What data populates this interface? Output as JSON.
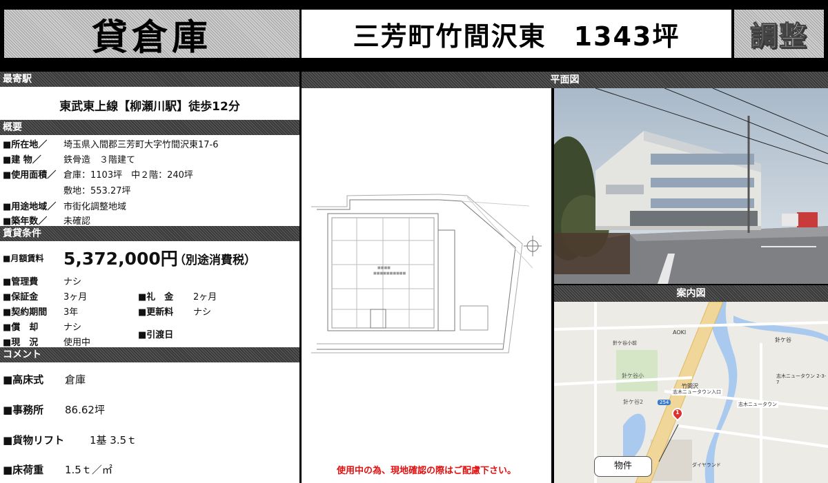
{
  "header": {
    "title": "貸倉庫",
    "subtitle": "三芳町竹間沢東　1343坪",
    "status": "調整"
  },
  "station": {
    "header": "最寄駅",
    "text": "東武東上線【柳瀬川駅】徒歩12分"
  },
  "overview": {
    "header": "概要",
    "location_label": "■所在地／",
    "location_value": "埼玉県入間郡三芳町大字竹間沢東17-6",
    "building_label": "■建 物／",
    "building_value": "鉄骨造　３階建て",
    "area_label": "■使用面積／",
    "area_value": "倉庫：1103坪　中２階：240坪",
    "site_value": "敷地：553.27坪",
    "zone_label": "■用途地域／",
    "zone_value": "市街化調整地域",
    "age_label": "■築年数／",
    "age_value": "未確認"
  },
  "lease": {
    "header": "賃貸条件",
    "rent_label": "■月額賃料",
    "rent_value": "5,372,000円",
    "rent_tax": "（別途消費税）",
    "mgmt_label": "■管理費",
    "mgmt_value": "ナシ",
    "deposit_label": "■保証金",
    "deposit_value": "3ヶ月",
    "key_label": "■礼　金",
    "key_value": "2ヶ月",
    "term_label": "■契約期間",
    "term_value": "3年",
    "renew_label": "■更新料",
    "renew_value": "ナシ",
    "amort_label": "■償　却",
    "amort_value": "ナシ",
    "current_label": "■現　況",
    "current_value": "使用中",
    "handover_label": "■引渡日"
  },
  "comment": {
    "header": "コメント",
    "items": [
      {
        "label": "■高床式",
        "value": "倉庫"
      },
      {
        "label": "■事務所",
        "value": "86.62坪"
      },
      {
        "label": "■貨物リフト",
        "value": "1基 3.5ｔ"
      },
      {
        "label": "■床荷重",
        "value": "1.5ｔ／㎡"
      }
    ]
  },
  "floorplan": {
    "header": "平面図",
    "notice": "使用中の為、現地確認の際はご配慮下さい。"
  },
  "map": {
    "header": "案内図",
    "marker_label": "物件",
    "marker_num": "1",
    "labels": {
      "aoki": "AOKI",
      "harigaya_sho": "針ケ谷小",
      "harigaya2": "針ケ谷2",
      "takemazawa": "竹間沢",
      "shiki_nt_iriguchi": "志木ニュータウン入口",
      "shiki_nt": "志木ニュータウン",
      "harigaya": "針ケ谷",
      "route": "254",
      "daiyaland": "ダイヤランド",
      "harigaya_sho2": "針ケ谷小前",
      "shiki_nt2": "志木ニュータウン 2-3-7"
    }
  }
}
